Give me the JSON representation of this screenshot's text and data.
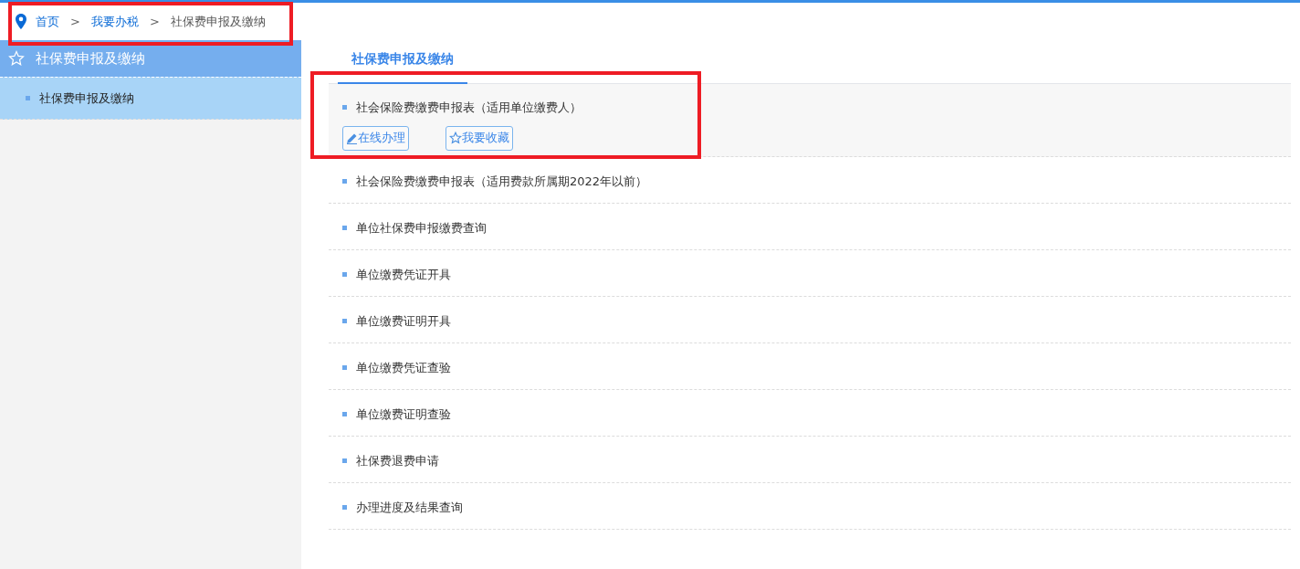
{
  "breadcrumb": [
    {
      "label": "首页",
      "kind": "link"
    },
    {
      "label": "我要办税",
      "kind": "link"
    },
    {
      "label": "社保费申报及缴纳",
      "kind": "current"
    }
  ],
  "breadcrumb_separator": ">",
  "sidebar": {
    "title": "社保费申报及缴纳",
    "items": [
      {
        "label": "社保费申报及缴纳",
        "selected": true
      }
    ]
  },
  "tabs": [
    {
      "label": "社保费申报及缴纳",
      "selected": true
    }
  ],
  "items": [
    {
      "label": "社会保险费缴费申报表（适用单位缴费人）",
      "expanded": true,
      "actions": [
        {
          "label": "在线办理",
          "kind": "edit"
        },
        {
          "label": "我要收藏",
          "kind": "favorite"
        }
      ]
    },
    {
      "label": "社会保险费缴费申报表（适用费款所属期2022年以前）",
      "expanded": false
    },
    {
      "label": "单位社保费申报缴费查询",
      "expanded": false
    },
    {
      "label": "单位缴费凭证开具",
      "expanded": false
    },
    {
      "label": "单位缴费证明开具",
      "expanded": false
    },
    {
      "label": "单位缴费凭证查验",
      "expanded": false
    },
    {
      "label": "单位缴费证明查验",
      "expanded": false
    },
    {
      "label": "社保费退费申请",
      "expanded": false
    },
    {
      "label": "办理进度及结果查询",
      "expanded": false
    }
  ]
}
